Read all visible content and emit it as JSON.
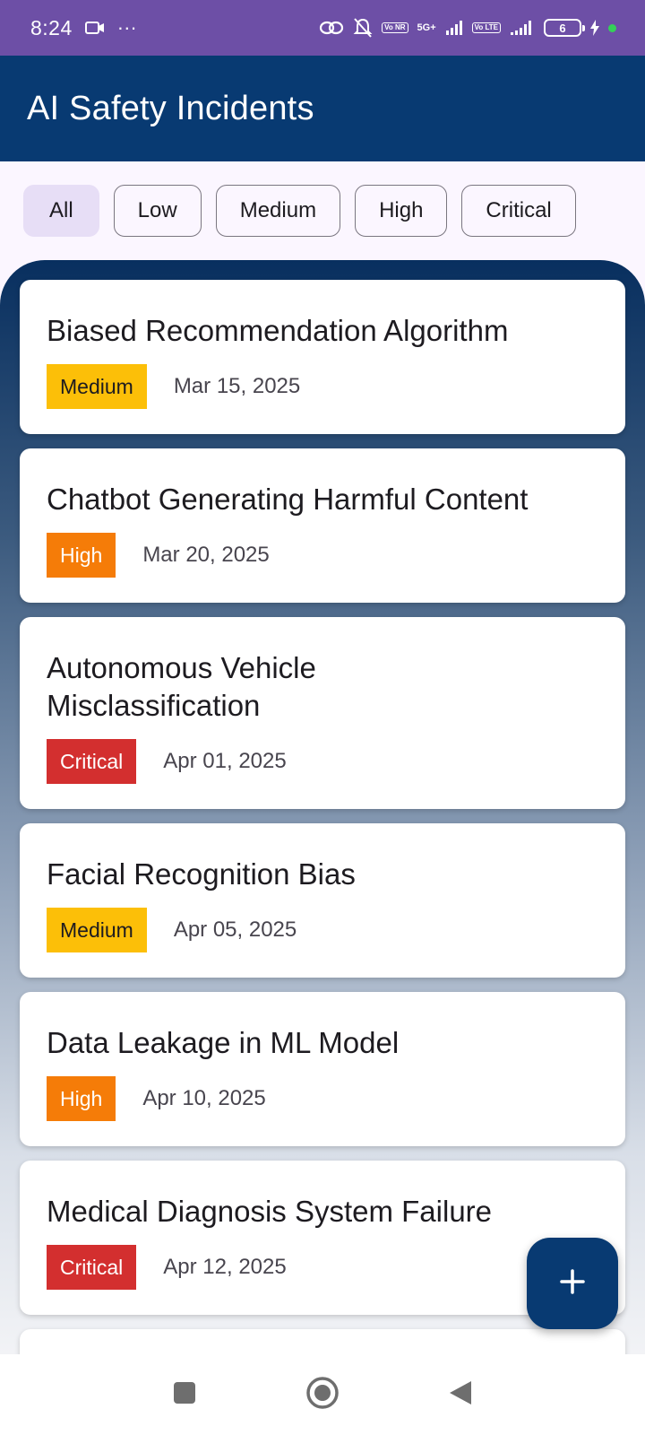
{
  "status_bar": {
    "time": "8:24",
    "dots": "···",
    "network_badge_1": "Vo NR",
    "network_label": "5G+",
    "network_badge_2": "Vo LTE",
    "battery_level": "6"
  },
  "app_bar": {
    "title": "AI Safety Incidents"
  },
  "filters": [
    {
      "label": "All",
      "selected": true
    },
    {
      "label": "Low",
      "selected": false
    },
    {
      "label": "Medium",
      "selected": false
    },
    {
      "label": "High",
      "selected": false
    },
    {
      "label": "Critical",
      "selected": false
    }
  ],
  "incidents": [
    {
      "title": "Biased Recommendation Algorithm",
      "severity": "Medium",
      "date": "Mar 15, 2025"
    },
    {
      "title": "Chatbot Generating Harmful Content",
      "severity": "High",
      "date": "Mar 20, 2025"
    },
    {
      "title": "Autonomous Vehicle Misclassification",
      "severity": "Critical",
      "date": "Apr 01, 2025"
    },
    {
      "title": "Facial Recognition Bias",
      "severity": "Medium",
      "date": "Apr 05, 2025"
    },
    {
      "title": "Data Leakage in ML Model",
      "severity": "High",
      "date": "Apr 10, 2025"
    },
    {
      "title": "Medical Diagnosis System Failure",
      "severity": "Critical",
      "date": "Apr 12, 2025"
    }
  ],
  "fab": {
    "icon": "plus-icon"
  },
  "colors": {
    "primary": "#083a72",
    "status_bar": "#6d4fa6",
    "medium": "#fcbf08",
    "high": "#f57c08",
    "critical": "#d32f2f"
  }
}
